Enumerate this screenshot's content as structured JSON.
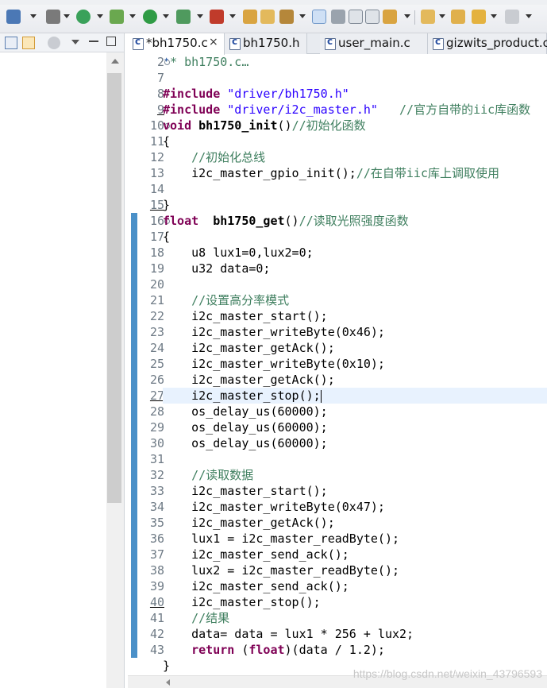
{
  "toolbar": {
    "items": [
      "save-icon",
      "build-icon",
      "debug-icon",
      "run-icon",
      "external-tools-icon",
      "open-type-icon",
      "open-folder-icon",
      "edit-icon",
      "highlight-icon",
      "next-annotation-icon",
      "show-whitespace-icon",
      "pin-icon",
      "back-icon",
      "forward-icon"
    ]
  },
  "tabs": [
    {
      "label": "*bh1750.c",
      "close": "×",
      "active": true
    },
    {
      "label": "bh1750.h",
      "active": false
    },
    {
      "label": "user_main.c",
      "active": false
    },
    {
      "label": "gizwits_product.c",
      "active": false
    }
  ],
  "colors": {
    "keyword": "#7f0055",
    "string": "#2a00ff",
    "comment": "#3f7f5f",
    "line_number": "#6e7a85",
    "ruler": "#4a90c8",
    "current_line": "#e8f2fe"
  },
  "editor": {
    "lines": [
      {
        "n": "2",
        "fold": "plus",
        "tokens": [
          {
            "t": " * bh1750.c",
            "c": "cmt"
          },
          {
            "t": "…",
            "c": "cmt"
          }
        ]
      },
      {
        "n": "7",
        "tokens": []
      },
      {
        "n": "8",
        "tokens": [
          {
            "t": "#include",
            "c": "kw"
          },
          {
            "t": " "
          },
          {
            "t": "\"driver/bh1750.h\"",
            "c": "str"
          }
        ]
      },
      {
        "n": "9",
        "tokens": [
          {
            "t": "#include",
            "c": "kw"
          },
          {
            "t": " "
          },
          {
            "t": "\"driver/i2c_master.h\"",
            "c": "str"
          },
          {
            "t": "   "
          },
          {
            "t": "//官方自带的iic库函数",
            "c": "cmt"
          }
        ]
      },
      {
        "n": "10",
        "fold": "minus",
        "tokens": [
          {
            "t": "void",
            "c": "kw"
          },
          {
            "t": " "
          },
          {
            "t": "bh1750_init",
            "c": "fn"
          },
          {
            "t": "()"
          },
          {
            "t": "//初始化函数",
            "c": "cmt"
          }
        ]
      },
      {
        "n": "11",
        "tokens": [
          {
            "t": "{"
          }
        ]
      },
      {
        "n": "12",
        "tokens": [
          {
            "t": "    "
          },
          {
            "t": "//初始化总线",
            "c": "cmt"
          }
        ]
      },
      {
        "n": "13",
        "tokens": [
          {
            "t": "    i2c_master_gpio_init();"
          },
          {
            "t": "//在自带iic库上调取使用",
            "c": "cmt"
          }
        ]
      },
      {
        "n": "14",
        "tokens": []
      },
      {
        "n": "15",
        "tokens": [
          {
            "t": "}"
          }
        ]
      },
      {
        "n": "16",
        "fold": "minus",
        "tokens": [
          {
            "t": "float",
            "c": "kw"
          },
          {
            "t": "  "
          },
          {
            "t": "bh1750_get",
            "c": "fn"
          },
          {
            "t": "()"
          },
          {
            "t": "//读取光照强度函数",
            "c": "cmt"
          }
        ]
      },
      {
        "n": "17",
        "tokens": [
          {
            "t": "{"
          }
        ]
      },
      {
        "n": "18",
        "tokens": [
          {
            "t": "    u8 lux1=0,lux2=0;"
          }
        ]
      },
      {
        "n": "19",
        "tokens": [
          {
            "t": "    u32 data=0;"
          }
        ]
      },
      {
        "n": "20",
        "tokens": []
      },
      {
        "n": "21",
        "tokens": [
          {
            "t": "    "
          },
          {
            "t": "//设置高分率模式",
            "c": "cmt"
          }
        ]
      },
      {
        "n": "22",
        "tokens": [
          {
            "t": "    i2c_master_start();"
          }
        ]
      },
      {
        "n": "23",
        "tokens": [
          {
            "t": "    i2c_master_writeByte(0x46);"
          }
        ]
      },
      {
        "n": "24",
        "tokens": [
          {
            "t": "    i2c_master_getAck();"
          }
        ]
      },
      {
        "n": "25",
        "tokens": [
          {
            "t": "    i2c_master_writeByte(0x10);"
          }
        ]
      },
      {
        "n": "26",
        "tokens": [
          {
            "t": "    i2c_master_getAck();"
          }
        ]
      },
      {
        "n": "27",
        "current": true,
        "tokens": [
          {
            "t": "    i2c_master_stop();"
          }
        ]
      },
      {
        "n": "28",
        "tokens": [
          {
            "t": "    os_delay_us(60000);"
          }
        ]
      },
      {
        "n": "29",
        "tokens": [
          {
            "t": "    os_delay_us(60000);"
          }
        ]
      },
      {
        "n": "30",
        "tokens": [
          {
            "t": "    os_delay_us(60000);"
          }
        ]
      },
      {
        "n": "31",
        "tokens": []
      },
      {
        "n": "32",
        "tokens": [
          {
            "t": "    "
          },
          {
            "t": "//读取数据",
            "c": "cmt"
          }
        ]
      },
      {
        "n": "33",
        "tokens": [
          {
            "t": "    i2c_master_start();"
          }
        ]
      },
      {
        "n": "34",
        "tokens": [
          {
            "t": "    i2c_master_writeByte(0x47);"
          }
        ]
      },
      {
        "n": "35",
        "tokens": [
          {
            "t": "    i2c_master_getAck();"
          }
        ]
      },
      {
        "n": "36",
        "tokens": [
          {
            "t": "    lux1 = i2c_master_readByte();"
          }
        ]
      },
      {
        "n": "37",
        "tokens": [
          {
            "t": "    i2c_master_send_ack();"
          }
        ]
      },
      {
        "n": "38",
        "tokens": [
          {
            "t": "    lux2 = i2c_master_readByte();"
          }
        ]
      },
      {
        "n": "39",
        "tokens": [
          {
            "t": "    i2c_master_send_ack();"
          }
        ]
      },
      {
        "n": "40",
        "tokens": [
          {
            "t": "    i2c_master_stop();"
          }
        ]
      },
      {
        "n": "41",
        "tokens": [
          {
            "t": "    "
          },
          {
            "t": "//结果",
            "c": "cmt"
          }
        ]
      },
      {
        "n": "42",
        "tokens": [
          {
            "t": "    data= data = lux1 * 256 + lux2;"
          }
        ]
      },
      {
        "n": "43",
        "tokens": [
          {
            "t": "    "
          },
          {
            "t": "return",
            "c": "kw"
          },
          {
            "t": " ("
          },
          {
            "t": "float",
            "c": "kw"
          },
          {
            "t": ")(data / 1.2);"
          }
        ]
      },
      {
        "n": "",
        "tokens": [
          {
            "t": "}"
          }
        ]
      }
    ]
  },
  "watermark": "https://blog.csdn.net/weixin_43796593"
}
